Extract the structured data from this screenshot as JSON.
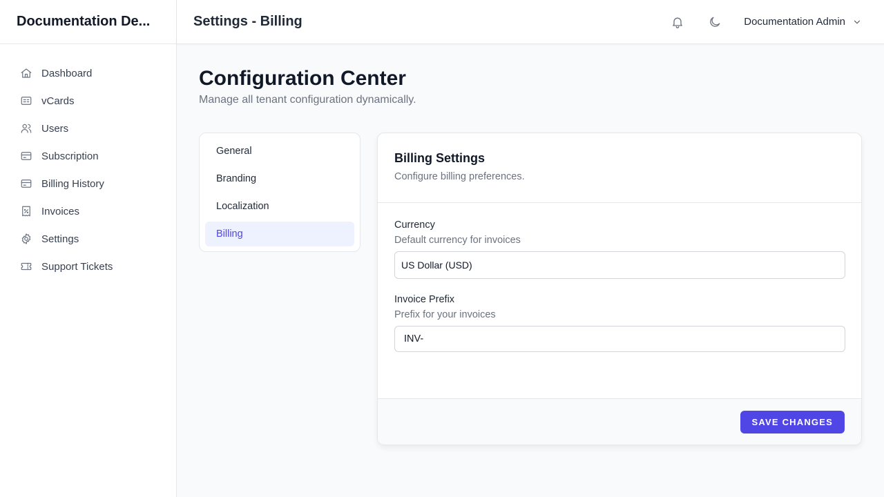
{
  "app": {
    "brand": "Documentation De..."
  },
  "sidebar": {
    "items": [
      {
        "label": "Dashboard",
        "icon": "home-icon"
      },
      {
        "label": "vCards",
        "icon": "id-card-icon"
      },
      {
        "label": "Users",
        "icon": "users-icon"
      },
      {
        "label": "Subscription",
        "icon": "credit-card-icon"
      },
      {
        "label": "Billing History",
        "icon": "credit-card-icon"
      },
      {
        "label": "Invoices",
        "icon": "receipt-percent-icon"
      },
      {
        "label": "Settings",
        "icon": "gear-icon"
      },
      {
        "label": "Support Tickets",
        "icon": "ticket-icon"
      }
    ]
  },
  "header": {
    "title": "Settings - Billing",
    "user_name": "Documentation Admin"
  },
  "page": {
    "title": "Configuration Center",
    "subtitle": "Manage all tenant configuration dynamically."
  },
  "tabs": [
    {
      "label": "General",
      "active": false
    },
    {
      "label": "Branding",
      "active": false
    },
    {
      "label": "Localization",
      "active": false
    },
    {
      "label": "Billing",
      "active": true
    }
  ],
  "billing": {
    "title": "Billing Settings",
    "description": "Configure billing preferences.",
    "currency": {
      "label": "Currency",
      "hint": "Default currency for invoices",
      "value": "US Dollar (USD)"
    },
    "invoice_prefix": {
      "label": "Invoice Prefix",
      "hint": "Prefix for your invoices",
      "value": "INV-"
    },
    "save_label": "SAVE CHANGES"
  },
  "colors": {
    "accent": "#4f46e5",
    "active_tab_bg": "#eef2ff"
  }
}
